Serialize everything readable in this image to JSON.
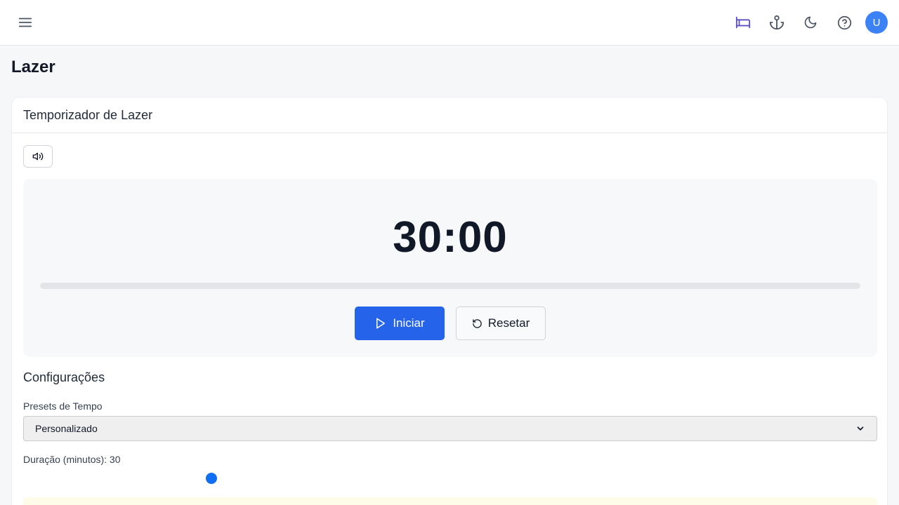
{
  "header": {
    "menu_icon": "hamburger-menu-icon",
    "icons": [
      "bed-icon",
      "anchor-icon",
      "moon-icon",
      "help-circle-icon"
    ],
    "active_icon_color": "#5b4fc4",
    "icon_color": "#4b5563",
    "avatar_initial": "U",
    "avatar_color": "#3b82f6"
  },
  "page": {
    "title": "Lazer"
  },
  "timer_card": {
    "title": "Temporizador de Lazer",
    "sound_icon": "volume-icon",
    "display": "30:00",
    "progress": 0,
    "start_label": "Iniciar",
    "start_icon": "play-icon",
    "reset_label": "Resetar",
    "reset_icon": "rotate-ccw-icon",
    "accent_color": "#2563eb"
  },
  "settings": {
    "title": "Configurações",
    "preset_label": "Presets de Tempo",
    "preset_value": "Personalizado",
    "duration_label": "Duração (minutos): 30",
    "duration_minutes": 30,
    "slider_fraction": 0.22
  }
}
